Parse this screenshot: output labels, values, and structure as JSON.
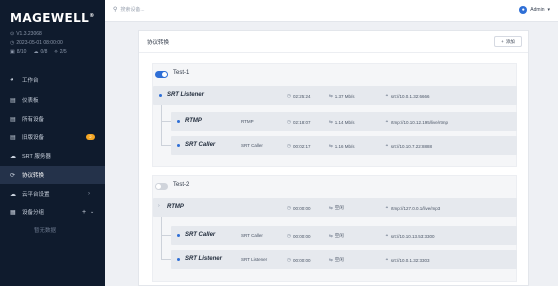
{
  "sidebar": {
    "logo": "MAGEWELL",
    "version": "V1.3.23068",
    "datetime": "2023-05-01 08:00:00",
    "stats": [
      "8/10",
      "0/8",
      "2/5"
    ],
    "items": [
      {
        "label": "工作台",
        "icon": "dashboard-icon"
      },
      {
        "label": "仪表板",
        "icon": "board-icon"
      },
      {
        "label": "所有设备",
        "icon": "devices-icon"
      },
      {
        "label": "旧版设备",
        "icon": "legacy-devices-icon",
        "badge": "2"
      },
      {
        "label": "SRT 服务器",
        "icon": "cloud-icon"
      },
      {
        "label": "协议转换",
        "icon": "convert-icon"
      },
      {
        "label": "云平台设置",
        "icon": "cloud-settings-icon"
      },
      {
        "label": "设备分组",
        "icon": "grid-icon"
      },
      {
        "label": "暂无数据"
      }
    ]
  },
  "header": {
    "search_placeholder": "搜索设备...",
    "user": "Admin"
  },
  "main": {
    "title": "协议转换",
    "add_label": "添加",
    "groups": [
      {
        "name": "Test-1",
        "enabled": true,
        "source": {
          "name": "SRT Listener",
          "uptime": "02:25:24",
          "rate": "1.37 Mb/s",
          "url": "srt://10.0.1.32:6666"
        },
        "outputs": [
          {
            "name": "RTMP",
            "mode": "RTMP",
            "uptime": "02:18:07",
            "rate": "1.14 Mb/s",
            "url": "rtmp://10.10.12.195/live/rtmp"
          },
          {
            "name": "SRT Caller",
            "mode": "SRT Caller",
            "uptime": "00:02:17",
            "rate": "1.16 Mb/s",
            "url": "srt://10.10.7.22:8888"
          }
        ]
      },
      {
        "name": "Test-2",
        "enabled": false,
        "source": {
          "name": "RTMP",
          "uptime": "00:00:00",
          "rate": "空闲",
          "url": "rtmp://127.0.0.1/live/mp3"
        },
        "outputs": [
          {
            "name": "SRT Caller",
            "mode": "SRT Caller",
            "uptime": "00:00:00",
            "rate": "空闲",
            "url": "srt://10.10.13.53:3300"
          },
          {
            "name": "SRT Listener",
            "mode": "SRT Listener",
            "uptime": "00:00:00",
            "rate": "空闲",
            "url": "srt://10.0.1.32:3303"
          }
        ]
      }
    ]
  },
  "colors": {
    "sidebar_bg": "#0f1b2d",
    "accent": "#2f6fd6",
    "badge": "#f5a623",
    "toggle_off": "#d0d4db"
  },
  "glyphs": {
    "clock": "◷",
    "rate": "⇆",
    "link": "🔗",
    "search": "⚲",
    "dot": "●",
    "arrow_right": "›",
    "plus": "+",
    "chevron_down": "⌄",
    "caret": "▾",
    "grid": "▦",
    "cloud": "☁",
    "sync": "⟳",
    "monitor": "▣"
  }
}
